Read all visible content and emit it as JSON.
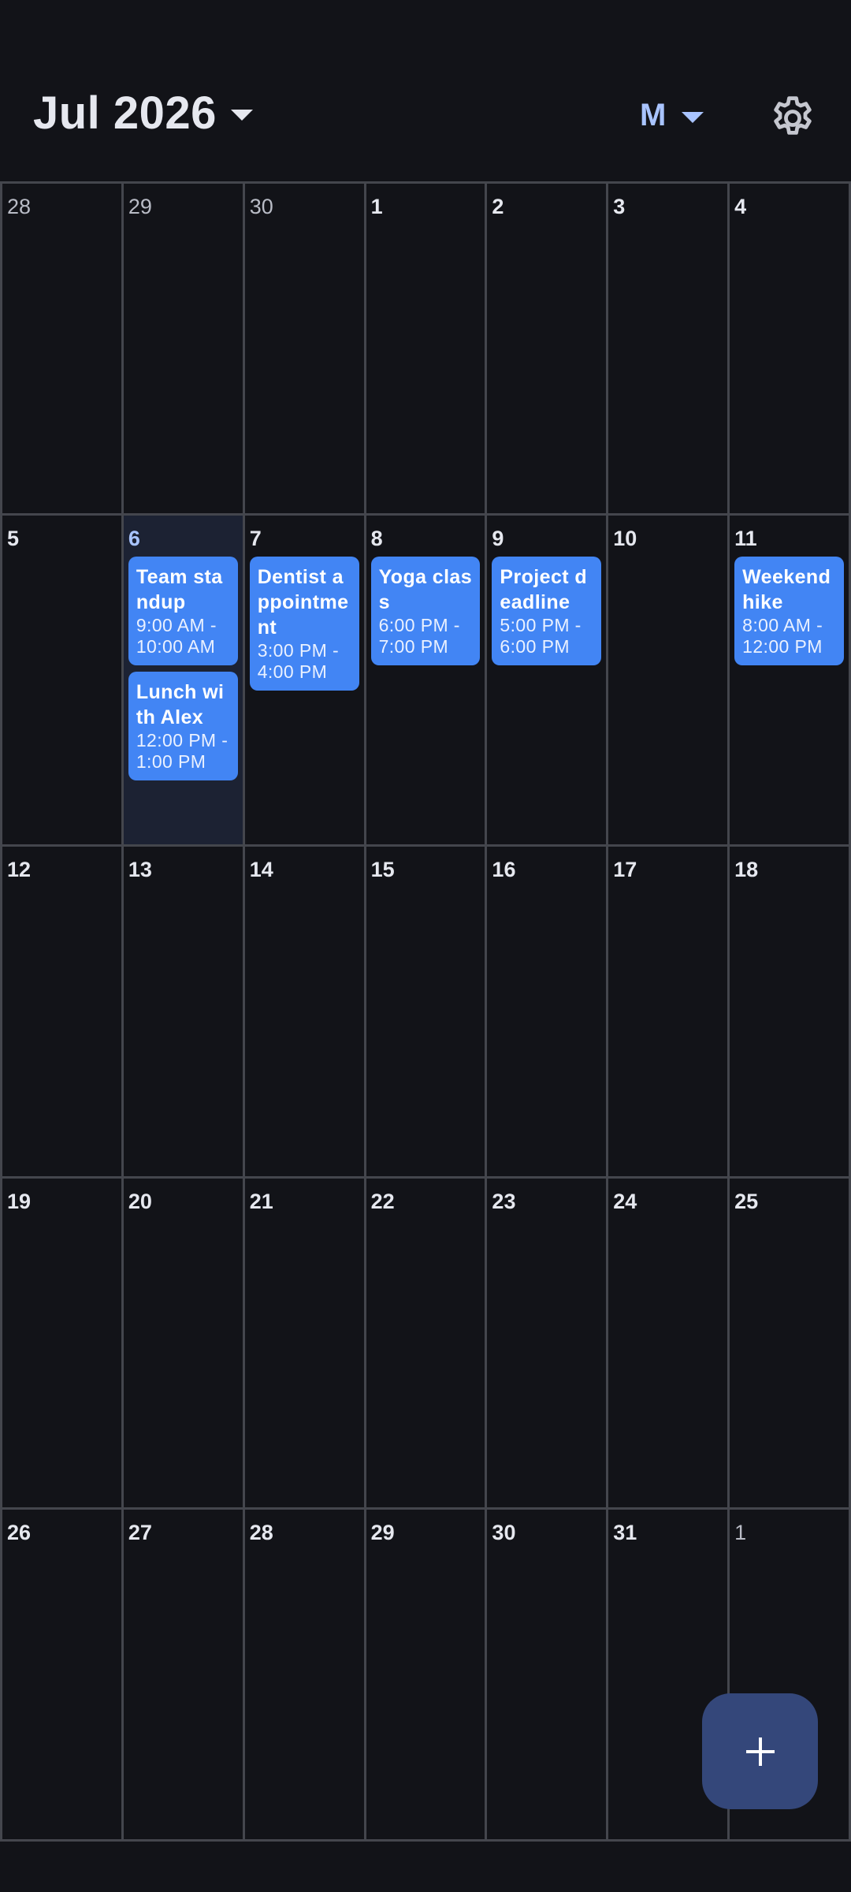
{
  "header": {
    "month_title": "Jul 2026",
    "view_label": "M",
    "icons": {
      "month_picker": "chevron-down-icon",
      "view_picker": "chevron-down-icon",
      "settings": "gear-icon"
    }
  },
  "colors": {
    "background": "#121318",
    "grid_line": "#44464d",
    "event_fill": "#4285f4",
    "today_fill": "#1c2233",
    "accent": "#a9c4ff",
    "fab_fill": "#34477a"
  },
  "weeks": [
    [
      {
        "day": "28",
        "other": true,
        "events": []
      },
      {
        "day": "29",
        "other": true,
        "events": []
      },
      {
        "day": "30",
        "other": true,
        "events": []
      },
      {
        "day": "1",
        "events": []
      },
      {
        "day": "2",
        "events": []
      },
      {
        "day": "3",
        "events": []
      },
      {
        "day": "4",
        "events": []
      }
    ],
    [
      {
        "day": "5",
        "events": []
      },
      {
        "day": "6",
        "today": true,
        "events": [
          {
            "title": "Team standup",
            "time": "9:00 AM - 10:00 AM"
          },
          {
            "title": "Lunch with Alex",
            "time": "12:00 PM - 1:00 PM"
          }
        ]
      },
      {
        "day": "7",
        "events": [
          {
            "title": "Dentist appointment",
            "time": "3:00 PM - 4:00 PM"
          }
        ]
      },
      {
        "day": "8",
        "events": [
          {
            "title": "Yoga class",
            "time": "6:00 PM - 7:00 PM"
          }
        ]
      },
      {
        "day": "9",
        "events": [
          {
            "title": "Project deadline",
            "time": "5:00 PM - 6:00 PM"
          }
        ]
      },
      {
        "day": "10",
        "events": []
      },
      {
        "day": "11",
        "events": [
          {
            "title": "Weekend hike",
            "time": "8:00 AM - 12:00 PM"
          }
        ]
      }
    ],
    [
      {
        "day": "12",
        "events": []
      },
      {
        "day": "13",
        "events": []
      },
      {
        "day": "14",
        "events": []
      },
      {
        "day": "15",
        "events": []
      },
      {
        "day": "16",
        "events": []
      },
      {
        "day": "17",
        "events": []
      },
      {
        "day": "18",
        "events": []
      }
    ],
    [
      {
        "day": "19",
        "events": []
      },
      {
        "day": "20",
        "events": []
      },
      {
        "day": "21",
        "events": []
      },
      {
        "day": "22",
        "events": []
      },
      {
        "day": "23",
        "events": []
      },
      {
        "day": "24",
        "events": []
      },
      {
        "day": "25",
        "events": []
      }
    ],
    [
      {
        "day": "26",
        "events": []
      },
      {
        "day": "27",
        "events": []
      },
      {
        "day": "28",
        "events": []
      },
      {
        "day": "29",
        "events": []
      },
      {
        "day": "30",
        "events": []
      },
      {
        "day": "31",
        "events": []
      },
      {
        "day": "1",
        "other": true,
        "events": []
      }
    ]
  ],
  "fab": {
    "icon": "plus-icon"
  }
}
